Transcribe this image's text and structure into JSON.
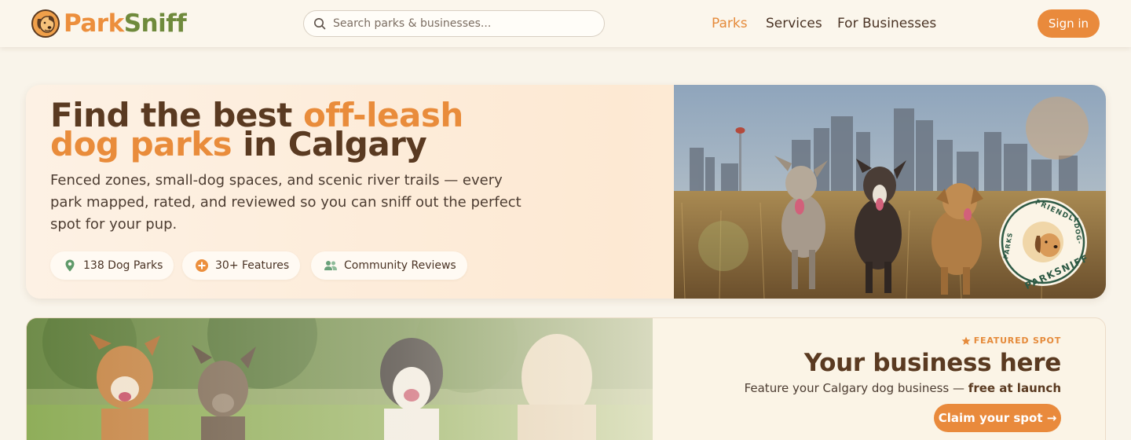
{
  "brand": {
    "part1": "Park",
    "part2": "Sniff"
  },
  "search": {
    "placeholder": "Search parks & businesses..."
  },
  "nav": {
    "links": [
      "Parks",
      "Services",
      "For Businesses"
    ],
    "active": "Parks",
    "signin_label": "Sign in"
  },
  "hero": {
    "title_part1": "Find the best ",
    "title_highlight1": "off-leash",
    "title_highlight2": "dog parks",
    "title_part2": " in Calgary",
    "description": "Fenced zones, small-dog spaces, and scenic river trails — every park mapped, rated, and reviewed so you can sniff out the perfect spot for your pup.",
    "chips": [
      {
        "icon": "map-pin-icon",
        "label": "138 Dog Parks"
      },
      {
        "icon": "plus-circle-icon",
        "label": "30+ Features"
      },
      {
        "icon": "people-icon",
        "label": "Community Reviews"
      }
    ],
    "badge_text": "PARKSNIFF · DOG-FRIENDLY · PARKS ·"
  },
  "featured": {
    "tag": "FEATURED SPOT",
    "title": "Your business here",
    "description": "Feature your Calgary dog business — ",
    "description_bold": "free at launch",
    "cta": "Claim your spot →"
  },
  "colors": {
    "accent": "#e98a3c",
    "brand_green": "#6f8a3c",
    "brown": "#5a3a21",
    "background": "#f9f4ea"
  }
}
